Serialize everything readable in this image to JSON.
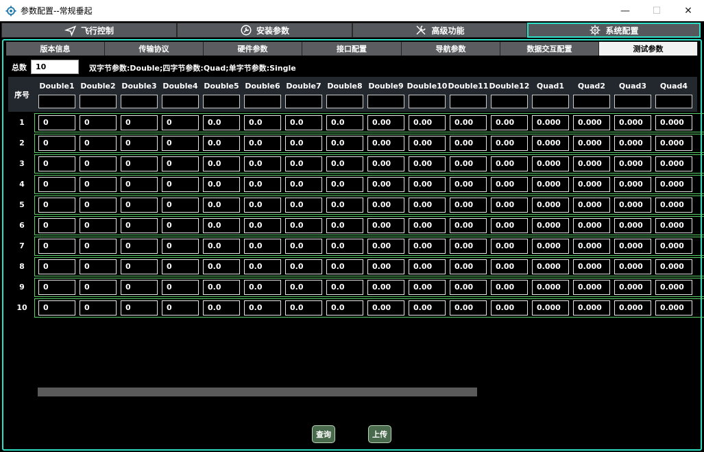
{
  "window": {
    "title": "参数配置--常规垂起",
    "minimize": "—",
    "maximize": "☐",
    "close": "✕"
  },
  "main_tabs": [
    {
      "label": "飞行控制",
      "icon": "airplane-icon"
    },
    {
      "label": "安装参数",
      "icon": "wrench-circle-icon"
    },
    {
      "label": "高级功能",
      "icon": "tools-icon"
    },
    {
      "label": "系统配置",
      "icon": "gear-icon",
      "active": true
    }
  ],
  "sub_tabs": [
    {
      "label": "版本信息"
    },
    {
      "label": "传输协议"
    },
    {
      "label": "硬件参数"
    },
    {
      "label": "接口配置"
    },
    {
      "label": "导航参数"
    },
    {
      "label": "数据交互配置"
    },
    {
      "label": "测试参数",
      "active": true
    }
  ],
  "total": {
    "label": "总数",
    "value": "10"
  },
  "hint": "双字节参数:Double;四字节参数:Quad;单字节参数:Single",
  "table": {
    "seq_header": "序号",
    "columns": [
      "Double1",
      "Double2",
      "Double3",
      "Double4",
      "Double5",
      "Double6",
      "Double7",
      "Double8",
      "Double9",
      "Double10",
      "Double11",
      "Double12",
      "Quad1",
      "Quad2",
      "Quad3",
      "Quad4"
    ],
    "rows": [
      {
        "num": "1",
        "values": [
          "0",
          "0",
          "0",
          "0",
          "0.0",
          "0.0",
          "0.0",
          "0.0",
          "0.00",
          "0.00",
          "0.00",
          "0.00",
          "0.000",
          "0.000",
          "0.000",
          "0.000"
        ]
      },
      {
        "num": "2",
        "values": [
          "0",
          "0",
          "0",
          "0",
          "0.0",
          "0.0",
          "0.0",
          "0.0",
          "0.00",
          "0.00",
          "0.00",
          "0.00",
          "0.000",
          "0.000",
          "0.000",
          "0.000"
        ]
      },
      {
        "num": "3",
        "values": [
          "0",
          "0",
          "0",
          "0",
          "0.0",
          "0.0",
          "0.0",
          "0.0",
          "0.00",
          "0.00",
          "0.00",
          "0.00",
          "0.000",
          "0.000",
          "0.000",
          "0.000"
        ]
      },
      {
        "num": "4",
        "values": [
          "0",
          "0",
          "0",
          "0",
          "0.0",
          "0.0",
          "0.0",
          "0.0",
          "0.00",
          "0.00",
          "0.00",
          "0.00",
          "0.000",
          "0.000",
          "0.000",
          "0.000"
        ]
      },
      {
        "num": "5",
        "values": [
          "0",
          "0",
          "0",
          "0",
          "0.0",
          "0.0",
          "0.0",
          "0.0",
          "0.00",
          "0.00",
          "0.00",
          "0.00",
          "0.000",
          "0.000",
          "0.000",
          "0.000"
        ]
      },
      {
        "num": "6",
        "values": [
          "0",
          "0",
          "0",
          "0",
          "0.0",
          "0.0",
          "0.0",
          "0.0",
          "0.00",
          "0.00",
          "0.00",
          "0.00",
          "0.000",
          "0.000",
          "0.000",
          "0.000"
        ]
      },
      {
        "num": "7",
        "values": [
          "0",
          "0",
          "0",
          "0",
          "0.0",
          "0.0",
          "0.0",
          "0.0",
          "0.00",
          "0.00",
          "0.00",
          "0.00",
          "0.000",
          "0.000",
          "0.000",
          "0.000"
        ]
      },
      {
        "num": "8",
        "values": [
          "0",
          "0",
          "0",
          "0",
          "0.0",
          "0.0",
          "0.0",
          "0.0",
          "0.00",
          "0.00",
          "0.00",
          "0.00",
          "0.000",
          "0.000",
          "0.000",
          "0.000"
        ]
      },
      {
        "num": "9",
        "values": [
          "0",
          "0",
          "0",
          "0",
          "0.0",
          "0.0",
          "0.0",
          "0.0",
          "0.00",
          "0.00",
          "0.00",
          "0.00",
          "0.000",
          "0.000",
          "0.000",
          "0.000"
        ]
      },
      {
        "num": "10",
        "values": [
          "0",
          "0",
          "0",
          "0",
          "0.0",
          "0.0",
          "0.0",
          "0.0",
          "0.00",
          "0.00",
          "0.00",
          "0.00",
          "0.000",
          "0.000",
          "0.000",
          "0.000"
        ]
      }
    ]
  },
  "buttons": {
    "query": "查询",
    "upload": "上传"
  },
  "colors": {
    "accent": "#2fe0c6",
    "row_border": "#5cd06a",
    "button": "#4a6a4e"
  }
}
